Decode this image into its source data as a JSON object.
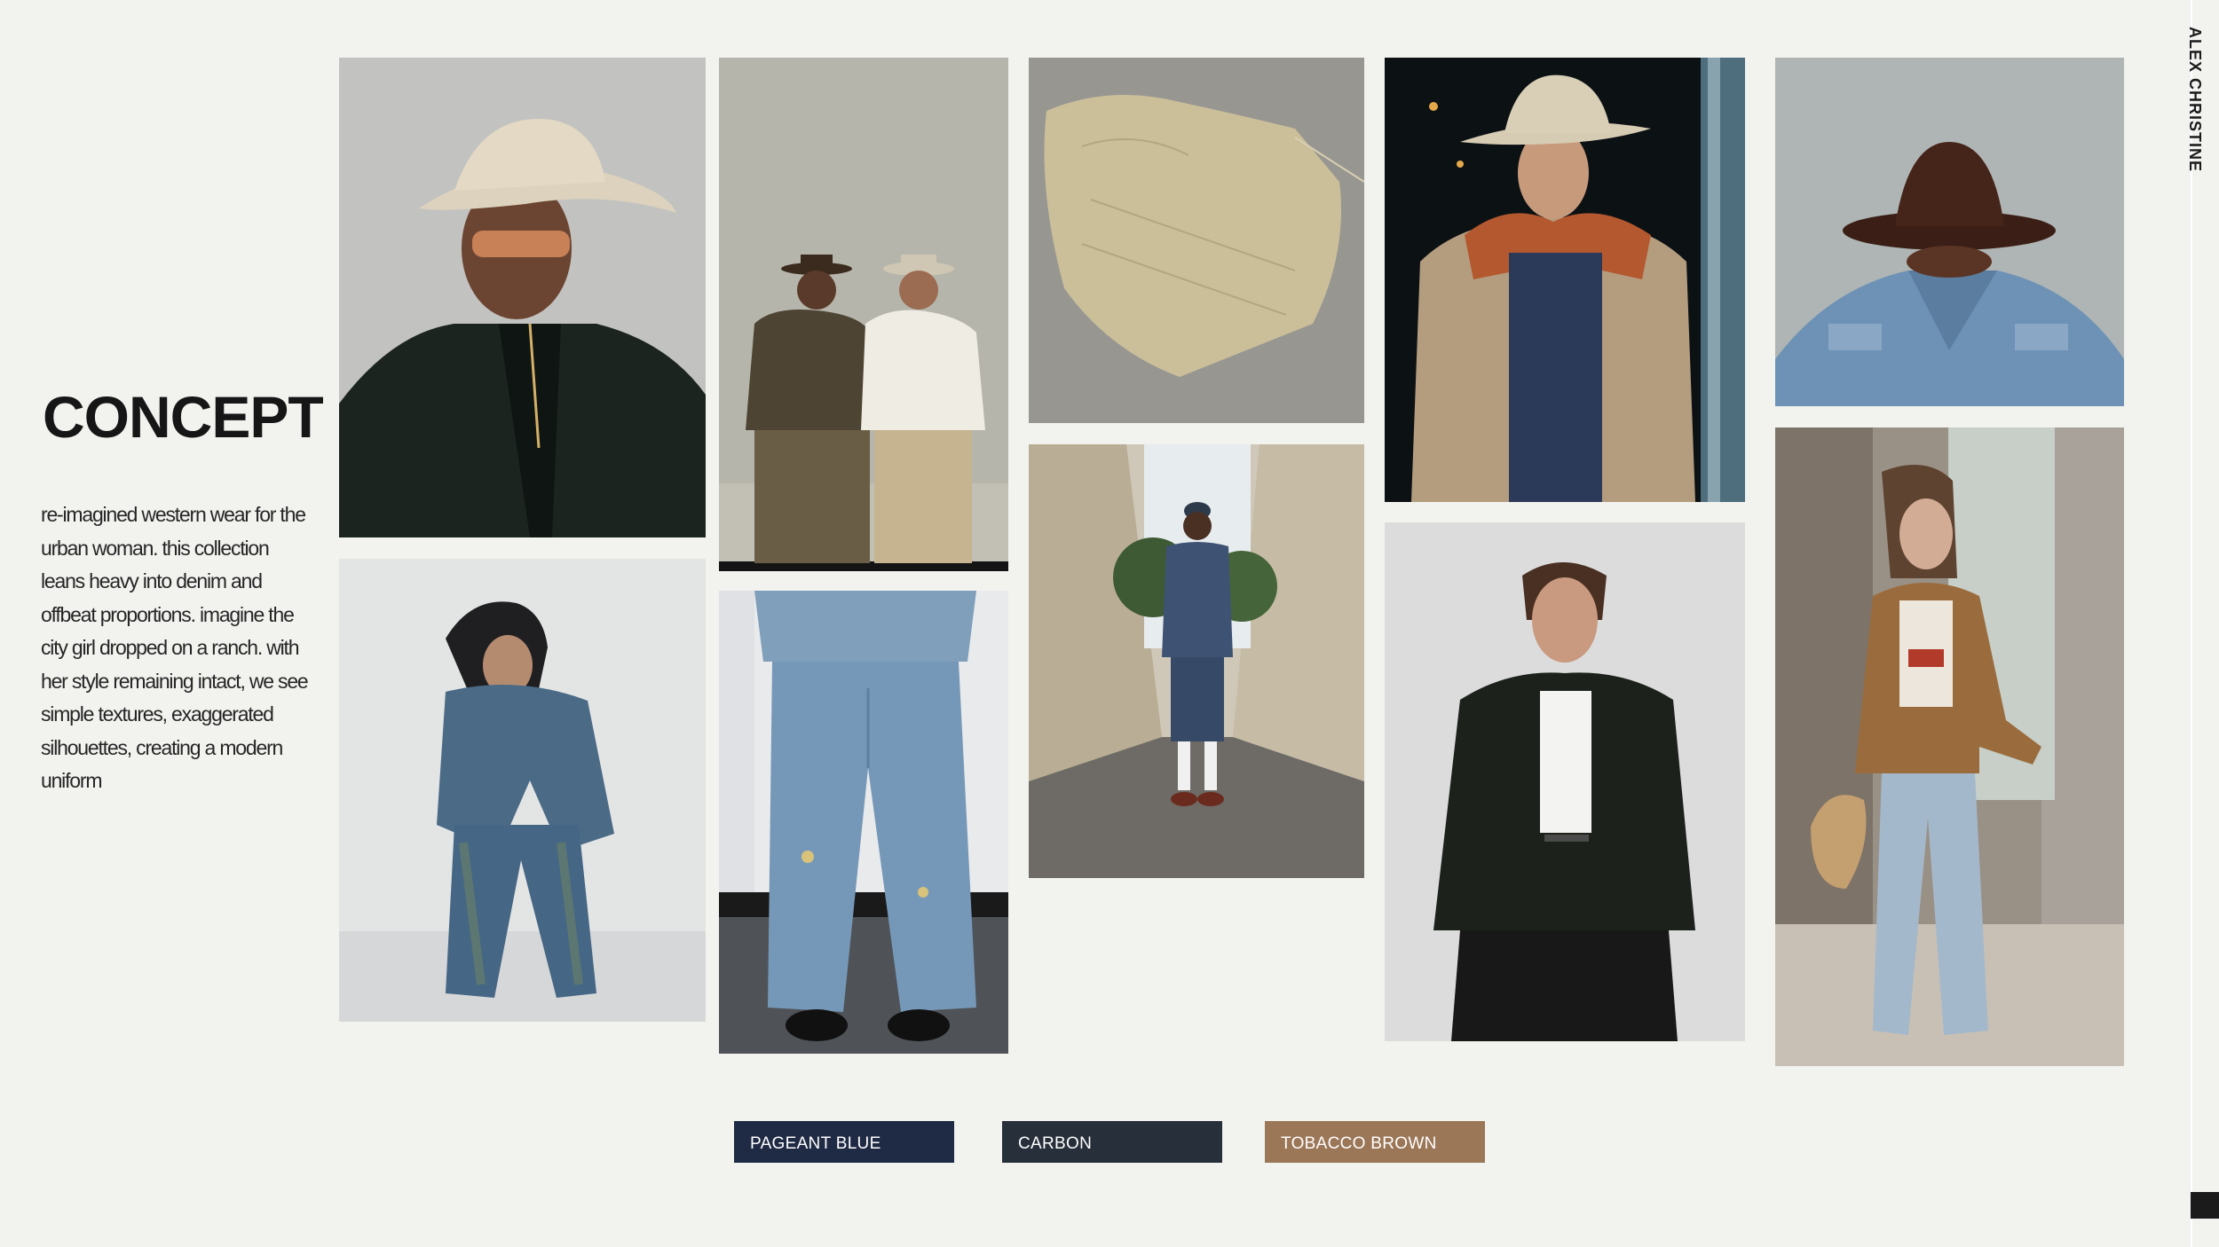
{
  "slide": {
    "title": "CONCEPT",
    "description": "re-imagined western wear for the urban woman. this collection leans heavy into denim and offbeat proportions. imagine the city girl dropped on a ranch. with her style remaining intact, we see simple textures, exaggerated silhouettes, creating a modern uniform",
    "designer": "ALEX CHRISTINE"
  },
  "palette": [
    {
      "label": "PAGEANT BLUE",
      "color": "#1f2a44"
    },
    {
      "label": "CARBON",
      "color": "#272f3b"
    },
    {
      "label": "TOBACCO BROWN",
      "color": "#9b7657"
    }
  ],
  "photos": [
    {
      "name": "photo-man-straw-cowboy-hat"
    },
    {
      "name": "photo-two-men-western-hats"
    },
    {
      "name": "photo-quilted-vest"
    },
    {
      "name": "photo-man-ranch-jacket"
    },
    {
      "name": "photo-denim-jacket-brown-hat"
    },
    {
      "name": "photo-woman-denim-set"
    },
    {
      "name": "photo-baggy-jeans"
    },
    {
      "name": "photo-man-street-denim"
    },
    {
      "name": "photo-man-leather-jacket"
    },
    {
      "name": "photo-woman-suede-jacket"
    }
  ]
}
